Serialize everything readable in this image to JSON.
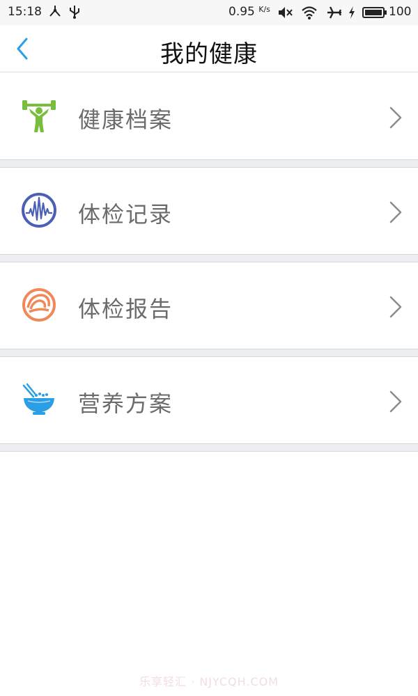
{
  "status_bar": {
    "time": "15:18",
    "net_speed": "0.95",
    "net_unit": "K/s",
    "battery": "100"
  },
  "header": {
    "title": "我的健康",
    "back_icon": "chevron-left-icon"
  },
  "menu": {
    "items": [
      {
        "label": "健康档案",
        "icon": "fitness-icon",
        "color": "#79bd3d"
      },
      {
        "label": "体检记录",
        "icon": "heartbeat-wave-icon",
        "color": "#4a5fb5"
      },
      {
        "label": "体检报告",
        "icon": "report-swirl-icon",
        "color": "#f0895a"
      },
      {
        "label": "营养方案",
        "icon": "rice-bowl-icon",
        "color": "#2b9fe6"
      }
    ]
  },
  "watermark": "乐享轻汇 · NJYCQH.COM",
  "colors": {
    "accent": "#2b9fe6",
    "separator": "#eceef2"
  }
}
